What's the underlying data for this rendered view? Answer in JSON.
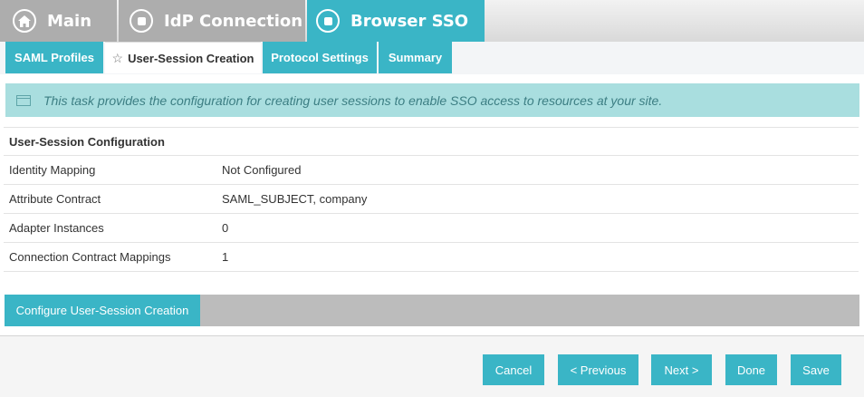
{
  "main_tabs": [
    {
      "label": "Main",
      "icon": "home-icon"
    },
    {
      "label": "IdP Connection",
      "icon": "stop-icon"
    },
    {
      "label": "Browser SSO",
      "icon": "stop-icon"
    }
  ],
  "sub_tabs": [
    {
      "label": "SAML Profiles"
    },
    {
      "label": "User-Session Creation",
      "active": true
    },
    {
      "label": "Protocol Settings"
    },
    {
      "label": "Summary"
    }
  ],
  "banner": {
    "text": "This task provides the configuration for creating user sessions to enable SSO access to resources at your site."
  },
  "config": {
    "heading": "User-Session Configuration",
    "rows": [
      {
        "label": "Identity Mapping",
        "value": "Not Configured"
      },
      {
        "label": "Attribute Contract",
        "value": "SAML_SUBJECT, company"
      },
      {
        "label": "Adapter Instances",
        "value": "0"
      },
      {
        "label": "Connection Contract Mappings",
        "value": "1"
      }
    ]
  },
  "configure_button": "Configure User-Session Creation",
  "footer": {
    "cancel": "Cancel",
    "previous": "< Previous",
    "next": "Next >",
    "done": "Done",
    "save": "Save"
  },
  "colors": {
    "accent": "#3ab5c6",
    "inactive_tab": "#adadad",
    "banner_bg": "#a9dedf",
    "banner_text": "#3c7e83"
  }
}
